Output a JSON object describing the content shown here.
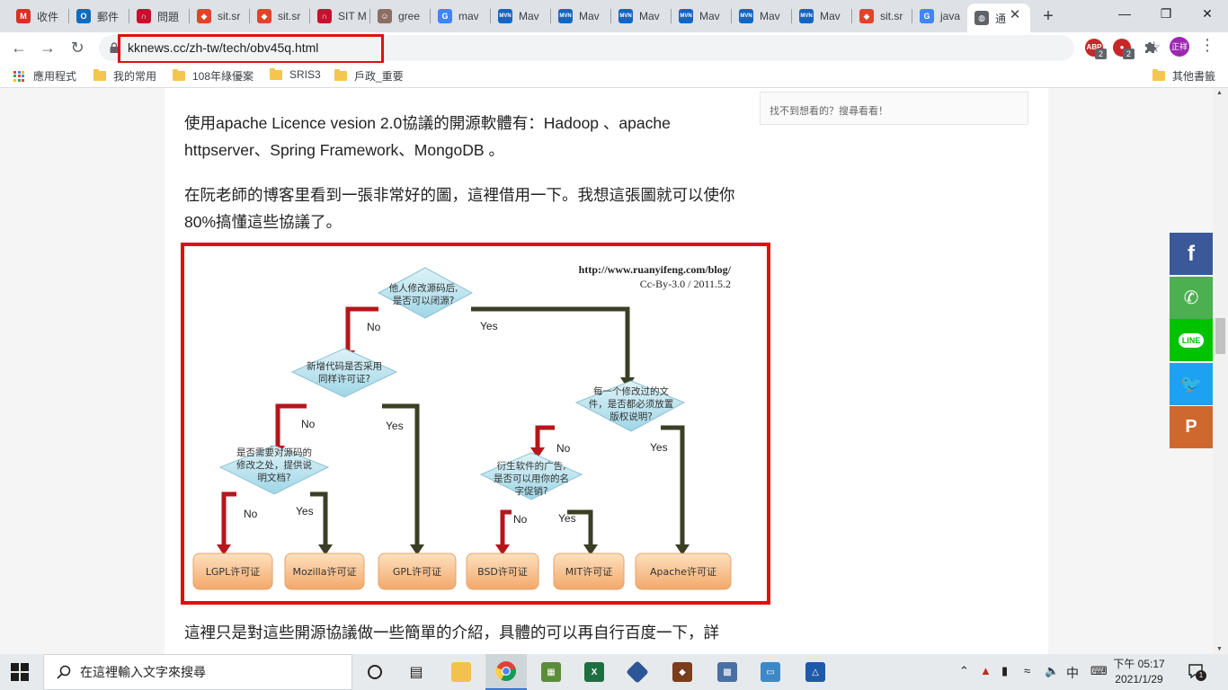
{
  "window": {
    "minimize_icon": "minimize-icon",
    "maximize_icon": "restore-icon",
    "close_icon": "close-icon"
  },
  "tabs": [
    {
      "title": "收件",
      "icon": "gmail-icon",
      "color": "#d93025",
      "glyph": "M"
    },
    {
      "title": "郵件",
      "icon": "outlook-icon",
      "color": "#0f6cbd",
      "glyph": "O"
    },
    {
      "title": "問題",
      "icon": "redmine-icon",
      "color": "#c8102e",
      "glyph": "∩"
    },
    {
      "title": "sit.sr",
      "icon": "gitlab-icon",
      "color": "#e24329",
      "glyph": "◆"
    },
    {
      "title": "sit.sr",
      "icon": "gitlab-icon",
      "color": "#e24329",
      "glyph": "◆"
    },
    {
      "title": "SIT M",
      "icon": "redmine-icon",
      "color": "#c8102e",
      "glyph": "∩"
    },
    {
      "title": "gree",
      "icon": "avatar-icon",
      "color": "#8d6e63",
      "glyph": "☺"
    },
    {
      "title": "mav",
      "icon": "google-icon",
      "color": "#4285f4",
      "glyph": "G"
    },
    {
      "title": "Mav",
      "icon": "maven-icon",
      "color": "#1565c0",
      "glyph": "MVN"
    },
    {
      "title": "Mav",
      "icon": "maven-icon",
      "color": "#1565c0",
      "glyph": "MVN"
    },
    {
      "title": "Mav",
      "icon": "maven-icon",
      "color": "#1565c0",
      "glyph": "MVN"
    },
    {
      "title": "Mav",
      "icon": "maven-icon",
      "color": "#1565c0",
      "glyph": "MVN"
    },
    {
      "title": "Mav",
      "icon": "maven-icon",
      "color": "#1565c0",
      "glyph": "MVN"
    },
    {
      "title": "Mav",
      "icon": "maven-icon",
      "color": "#1565c0",
      "glyph": "MVN"
    },
    {
      "title": "sit.sr",
      "icon": "gitlab-icon",
      "color": "#e24329",
      "glyph": "◆"
    },
    {
      "title": "java",
      "icon": "google-icon",
      "color": "#4285f4",
      "glyph": "G"
    },
    {
      "title": "通",
      "icon": "globe-icon",
      "color": "#5f6368",
      "glyph": "◍",
      "active": true
    }
  ],
  "toolbar": {
    "url": "kknews.cc/zh-tw/tech/obv45q.html",
    "back_icon": "back-arrow-icon",
    "forward_icon": "forward-arrow-icon",
    "reload_icon": "reload-icon",
    "star_icon": "bookmark-star-icon",
    "extensions": [
      {
        "name": "adblock-icon",
        "label": "ABP",
        "badge": "2",
        "color": "#c62828"
      },
      {
        "name": "ublock-icon",
        "label": "●",
        "badge": "2",
        "color": "#c62828"
      }
    ],
    "puzzle_icon": "extensions-puzzle-icon",
    "avatar_label": "正祥"
  },
  "bookmarks": {
    "apps_label": "應用程式",
    "items": [
      "我的常用",
      "108年綠優案",
      "SRIS3",
      "戶政_重要"
    ],
    "other_label": "其他書籤"
  },
  "article": {
    "search_hint": "找不到想看的？搜尋看看！",
    "para1": "使用apache Licence vesion 2.0協議的開源軟體有：Hadoop 、apache httpserver、Spring Framework、MongoDB 。",
    "para2": "在阮老師的博客里看到一張非常好的圖，這裡借用一下。我想這張圖就可以使你80%搞懂這些協議了。",
    "para3": "這裡只是對這些開源協議做一些簡單的介紹，具體的可以再自行百度一下，詳"
  },
  "diagram": {
    "credit_url": "http://www.ruanyifeng.com/blog/",
    "credit_license": "Cc-By-3.0 / 2011.5.2",
    "q1": [
      "他人修改源码后,",
      "是否可以闭源?"
    ],
    "q2": [
      "新增代码是否采用",
      "同样许可证?"
    ],
    "q3": [
      "是否需要对源码的",
      "修改之处，提供说",
      "明文档?"
    ],
    "q4": [
      "每一个修改过的文",
      "件，是否都必须放置",
      "版权说明?"
    ],
    "q5": [
      "衍生软件的广告,",
      "是否可以用你的名",
      "字促销?"
    ],
    "no": "No",
    "yes": "Yes",
    "licenses": [
      "LGPL许可证",
      "Mozilla许可证",
      "GPL许可证",
      "BSD许可证",
      "MIT许可证",
      "Apache许可证"
    ]
  },
  "share": [
    {
      "name": "facebook-share-icon",
      "color": "#3b5998",
      "glyph": "f"
    },
    {
      "name": "whatsapp-share-icon",
      "color": "#4caf50",
      "glyph": "✆"
    },
    {
      "name": "line-share-icon",
      "color": "#00c300",
      "glyph": "LINE"
    },
    {
      "name": "twitter-share-icon",
      "color": "#1da1f2",
      "glyph": "🐦"
    },
    {
      "name": "plurk-share-icon",
      "color": "#cf682f",
      "glyph": "P"
    }
  ],
  "taskbar": {
    "search_placeholder": "在這裡輸入文字來搜尋",
    "ime": "中",
    "time": "下午 05:17",
    "date": "2021/1/29",
    "notification_count": "1"
  }
}
